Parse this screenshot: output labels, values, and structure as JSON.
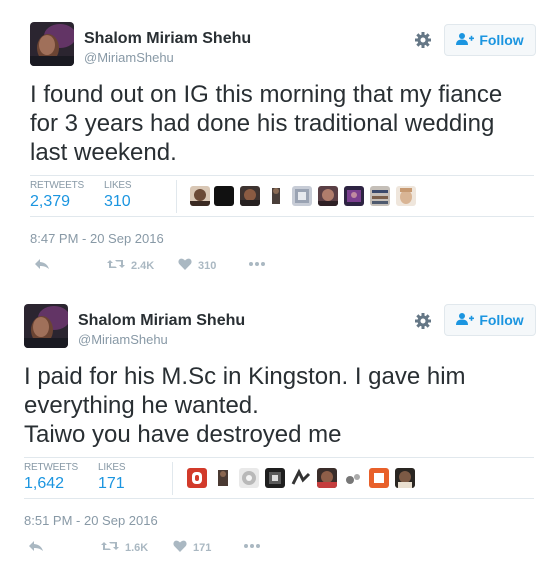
{
  "colors": {
    "link_blue": "#1b95e0",
    "muted_gray": "#8899a6",
    "icon_gray": "#aab8c2",
    "text": "#292f33",
    "border": "#e1e8ed"
  },
  "tweets": [
    {
      "author_name": "Shalom Miriam Shehu",
      "handle": "@MiriamShehu",
      "follow_label": "Follow",
      "text_lines": [
        "I found out on IG this morning that my fiance",
        "for 3 years had done his traditional wedding",
        "last weekend."
      ],
      "retweets_label": "RETWEETS",
      "retweets_count": "2,379",
      "likes_label": "LIKES",
      "likes_count": "310",
      "timestamp": "8:47 PM - 20 Sep 2016",
      "action_retweets": "2.4K",
      "action_likes": "310",
      "likers": [
        "avatar-1",
        "avatar-2",
        "avatar-3",
        "avatar-4",
        "avatar-5",
        "avatar-6",
        "avatar-7",
        "avatar-8",
        "avatar-9"
      ]
    },
    {
      "author_name": "Shalom Miriam Shehu",
      "handle": "@MiriamShehu",
      "follow_label": "Follow",
      "text_lines": [
        "I paid for his M.Sc in Kingston. I gave him",
        "everything he wanted.",
        "Taiwo you have destroyed me"
      ],
      "retweets_label": "RETWEETS",
      "retweets_count": "1,642",
      "likes_label": "LIKES",
      "likes_count": "171",
      "timestamp": "8:51 PM - 20 Sep 2016",
      "action_retweets": "1.6K",
      "action_likes": "171",
      "likers": [
        "avatar-1",
        "avatar-2",
        "avatar-3",
        "avatar-4",
        "avatar-5",
        "avatar-6",
        "avatar-7",
        "avatar-8",
        "avatar-9"
      ]
    }
  ]
}
